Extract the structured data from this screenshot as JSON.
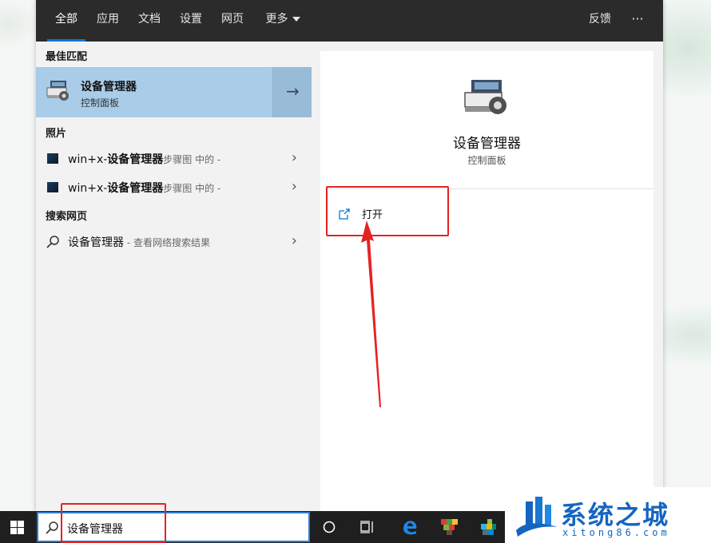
{
  "tabs": [
    {
      "label": "全部",
      "active": true
    },
    {
      "label": "应用"
    },
    {
      "label": "文档"
    },
    {
      "label": "设置"
    },
    {
      "label": "网页"
    },
    {
      "label": "更多"
    }
  ],
  "topbar_right": {
    "feedback": "反馈",
    "more": "···"
  },
  "sections": {
    "best_match": "最佳匹配",
    "photos": "照片",
    "web": "搜索网页"
  },
  "best_match": {
    "title": "设备管理器",
    "subtitle": "控制面板",
    "arrow": "→"
  },
  "photos": [
    {
      "prefix": "win+x-",
      "highlight": "设备管理器",
      "suffix": "步骤图",
      "location": " 中的 -"
    },
    {
      "prefix": "win+x-",
      "highlight": "设备管理器",
      "suffix": "步骤图",
      "location": " 中的 -"
    }
  ],
  "web_result": {
    "query": "设备管理器",
    "hint": " - 查看网络搜索结果"
  },
  "detail": {
    "title": "设备管理器",
    "subtitle": "控制面板",
    "open_label": "打开"
  },
  "search": {
    "value": "设备管理器"
  },
  "watermark": {
    "brand": "系统之城",
    "url": "xitong86.com"
  },
  "colors": {
    "accent": "#0078d7",
    "selection": "#a9cce8",
    "annotation": "#e52222",
    "taskbar": "#1f1f1f"
  }
}
